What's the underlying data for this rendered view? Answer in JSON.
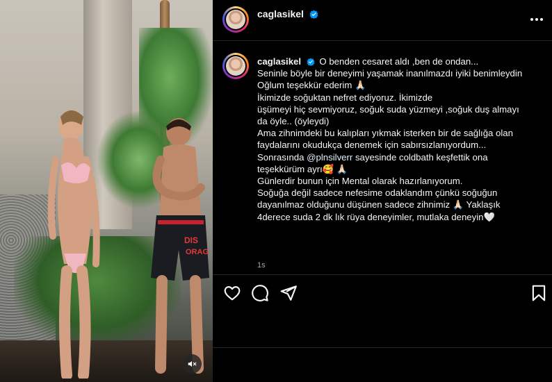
{
  "post": {
    "username": "caglasikel",
    "verified": true,
    "caption_lines": [
      "O benden cesaret aldı ,ben de ondan...",
      "Seninle böyle bir deneyimi yaşamak inanılmazdı iyiki benimleydin",
      "Oğlum teşekkür ederim 🙏🏻",
      "İkimizde soğuktan nefret ediyoruz. İkimizde",
      "üşümeyi hiç sevmiyoruz, soğuk suda yüzmeyi ,soğuk duş almayı",
      "da öyle.. (öyleydi)",
      "Ama zihnimdeki bu kalıpları yıkmak isterken bir de sağlığa olan",
      "faydalarını okudukça denemek için sabırsızlanıyordum...",
      "teşekkürüm ayrı🥰 🙏🏻",
      "Günlerdir bunun için Mental olarak hazırlanıyorum.",
      "Soğuğa değil sadece nefesime odaklandım çünkü soğuğun",
      "dayanılmaz olduğunu düşünen sadece zihnimiz 🙏🏻 Yaklaşık",
      "4derece suda 2 dk lık rüya deneyimler, mutlaka deneyin🤍"
    ],
    "mention_line": {
      "prefix": "Sonrasında ",
      "mention": "@plnsilverr",
      "suffix": " sayesinde coldbath keşfettik ona"
    },
    "timestamp": "1s"
  },
  "icons": {
    "more": "more-options-icon",
    "like": "heart-icon",
    "comment": "comment-icon",
    "share": "share-icon",
    "save": "bookmark-icon",
    "mute": "muted-speaker-icon",
    "verified": "verified-badge-icon"
  },
  "colors": {
    "background": "#000000",
    "text": "#f5f5f5",
    "secondary_text": "#a8a8a8",
    "verified_blue": "#0095f6",
    "divider": "#262626"
  }
}
